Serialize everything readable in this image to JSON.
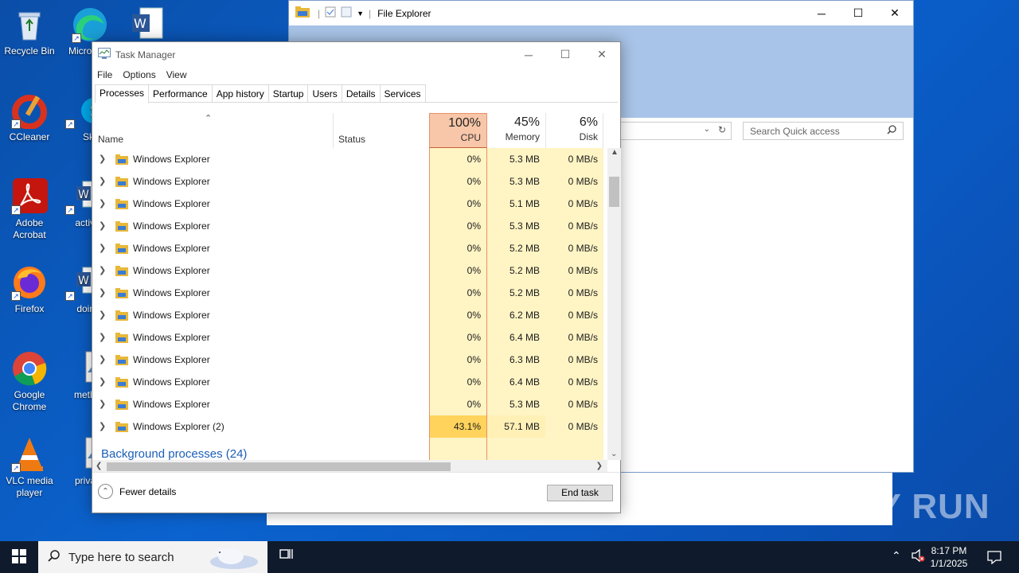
{
  "desktop": {
    "icons": [
      {
        "label": "Recycle Bin"
      },
      {
        "label": "Micro Edg"
      },
      {
        "label": "CCleaner"
      },
      {
        "label": "Sky"
      },
      {
        "label": "Adobe Acrobat"
      },
      {
        "label": "activiti"
      },
      {
        "label": "Firefox"
      },
      {
        "label": "doing"
      },
      {
        "label": "Google Chrome"
      },
      {
        "label": "method"
      },
      {
        "label": "VLC media player"
      },
      {
        "label": "privacy"
      }
    ]
  },
  "file_explorer": {
    "title": "File Explorer",
    "search_placeholder": "Search Quick access"
  },
  "task_manager": {
    "title": "Task Manager",
    "menu": [
      "File",
      "Options",
      "View"
    ],
    "tabs": [
      "Processes",
      "Performance",
      "App history",
      "Startup",
      "Users",
      "Details",
      "Services"
    ],
    "active_tab": "Processes",
    "columns": {
      "name": "Name",
      "status": "Status",
      "cpu": {
        "pct": "100%",
        "label": "CPU"
      },
      "memory": {
        "pct": "45%",
        "label": "Memory"
      },
      "disk": {
        "pct": "6%",
        "label": "Disk"
      }
    },
    "rows": [
      {
        "name": "Windows Explorer",
        "cpu": "0%",
        "memory": "5.3 MB",
        "disk": "0 MB/s"
      },
      {
        "name": "Windows Explorer",
        "cpu": "0%",
        "memory": "5.3 MB",
        "disk": "0 MB/s"
      },
      {
        "name": "Windows Explorer",
        "cpu": "0%",
        "memory": "5.1 MB",
        "disk": "0 MB/s"
      },
      {
        "name": "Windows Explorer",
        "cpu": "0%",
        "memory": "5.3 MB",
        "disk": "0 MB/s"
      },
      {
        "name": "Windows Explorer",
        "cpu": "0%",
        "memory": "5.2 MB",
        "disk": "0 MB/s"
      },
      {
        "name": "Windows Explorer",
        "cpu": "0%",
        "memory": "5.2 MB",
        "disk": "0 MB/s"
      },
      {
        "name": "Windows Explorer",
        "cpu": "0%",
        "memory": "5.2 MB",
        "disk": "0 MB/s"
      },
      {
        "name": "Windows Explorer",
        "cpu": "0%",
        "memory": "6.2 MB",
        "disk": "0 MB/s"
      },
      {
        "name": "Windows Explorer",
        "cpu": "0%",
        "memory": "6.4 MB",
        "disk": "0 MB/s"
      },
      {
        "name": "Windows Explorer",
        "cpu": "0%",
        "memory": "6.3 MB",
        "disk": "0 MB/s"
      },
      {
        "name": "Windows Explorer",
        "cpu": "0%",
        "memory": "6.4 MB",
        "disk": "0 MB/s"
      },
      {
        "name": "Windows Explorer",
        "cpu": "0%",
        "memory": "5.3 MB",
        "disk": "0 MB/s"
      },
      {
        "name": "Windows Explorer (2)",
        "cpu": "43.1%",
        "memory": "57.1 MB",
        "disk": "0 MB/s"
      }
    ],
    "section": "Background processes (24)",
    "fewer_details": "Fewer details",
    "end_task": "End task"
  },
  "taskbar": {
    "search_placeholder": "Type here to search",
    "time": "8:17 PM",
    "date": "1/1/2025"
  },
  "watermark": "ANY RUN"
}
